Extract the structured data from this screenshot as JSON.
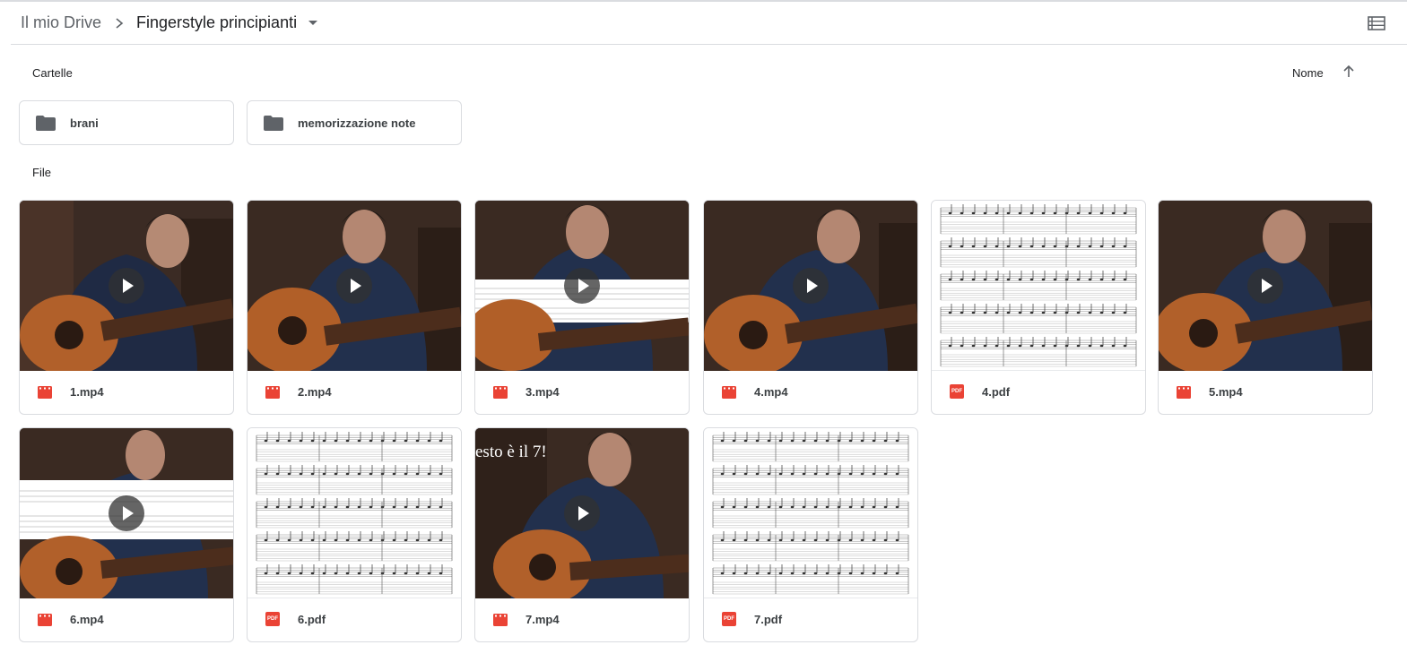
{
  "breadcrumb": {
    "root": "Il mio Drive",
    "current": "Fingerstyle principianti"
  },
  "sections": {
    "folders_label": "Cartelle",
    "files_label": "File"
  },
  "sort": {
    "label": "Nome",
    "direction": "ascending"
  },
  "folders": [
    {
      "name": "brani",
      "icon": "folder-icon"
    },
    {
      "name": "memorizzazione note",
      "icon": "folder-icon"
    }
  ],
  "files": [
    {
      "name": "1.mp4",
      "type": "video"
    },
    {
      "name": "2.mp4",
      "type": "video"
    },
    {
      "name": "3.mp4",
      "type": "video"
    },
    {
      "name": "4.mp4",
      "type": "video"
    },
    {
      "name": "4.pdf",
      "type": "pdf"
    },
    {
      "name": "5.mp4",
      "type": "video"
    },
    {
      "name": "6.mp4",
      "type": "video"
    },
    {
      "name": "6.pdf",
      "type": "pdf"
    },
    {
      "name": "7.mp4",
      "type": "video",
      "overlay_text": "esto è il 7!"
    },
    {
      "name": "7.pdf",
      "type": "pdf"
    }
  ],
  "icons": {
    "pdf_badge": "PDF",
    "video": "video-file-icon",
    "pdf": "pdf-file-icon",
    "play": "play-icon"
  },
  "colors": {
    "file_icon_red": "#ea4335",
    "border": "#dadce0",
    "text": "#3c4043"
  }
}
